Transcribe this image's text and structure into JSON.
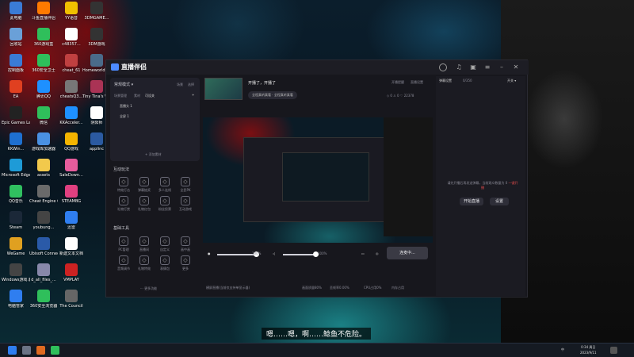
{
  "desktop": {
    "icons": [
      {
        "label": "此电脑",
        "color": "#3a7bd5"
      },
      {
        "label": "斗鱼直播伴侣",
        "color": "#ff7a00"
      },
      {
        "label": "YY语音",
        "color": "#f0c000"
      },
      {
        "label": "3DMGAME...",
        "color": "#333333"
      },
      {
        "label": "回收站",
        "color": "#6aa0d8"
      },
      {
        "label": "360游戏盒",
        "color": "#2fbf5b"
      },
      {
        "label": "c48357...",
        "color": "#ffffff"
      },
      {
        "label": "3DM游戏",
        "color": "#333333"
      },
      {
        "label": "控制面板",
        "color": "#3a7bd5"
      },
      {
        "label": "360安全卫士",
        "color": "#2fbf5b"
      },
      {
        "label": "cheat_61",
        "color": "#c04040"
      },
      {
        "label": "Homeworld Remaster...",
        "color": "#4a6b8a"
      },
      {
        "label": "EA",
        "color": "#e04020"
      },
      {
        "label": "腾讯QQ",
        "color": "#1e90ff"
      },
      {
        "label": "cheatsQ3...",
        "color": "#777777"
      },
      {
        "label": "Tiny Tina's Wonderlands",
        "color": "#aa3355"
      },
      {
        "label": "Epic Games Launcher",
        "color": "#222222"
      },
      {
        "label": "微信",
        "color": "#2fbf5b"
      },
      {
        "label": "KKAcceler...",
        "color": "#1e90ff"
      },
      {
        "label": "阴阳师",
        "color": "#ffffff"
      },
      {
        "label": "KKWin...",
        "color": "#1e6fd0"
      },
      {
        "label": "游戏库加速器",
        "color": "#4a90e2"
      },
      {
        "label": "QQ游戏",
        "color": "#f4b400"
      },
      {
        "label": "applinc",
        "color": "#2b5aa0"
      },
      {
        "label": "Microsoft Edge",
        "color": "#1e9bd7"
      },
      {
        "label": "assets",
        "color": "#f2c94c"
      },
      {
        "label": "SaleDown...",
        "color": "#e65c9c"
      },
      {
        "label": "QQ音乐",
        "color": "#30c060"
      },
      {
        "label": "Cheat Engine 61",
        "color": "#6a6a6a"
      },
      {
        "label": "STEAMBG",
        "color": "#e04080"
      },
      {
        "label": "Steam",
        "color": "#1b2838"
      },
      {
        "label": "youbung...",
        "color": "#444444"
      },
      {
        "label": "迅雷",
        "color": "#2f7ef0"
      },
      {
        "label": "WeGame",
        "color": "#e0a020"
      },
      {
        "label": "Ubisoft Connect",
        "color": "#2a5aa8"
      },
      {
        "label": "新建文本文档",
        "color": "#ffffff"
      },
      {
        "label": "Windows游戏 超级动画精灵",
        "color": "#444444"
      },
      {
        "label": "d_all_files_...",
        "color": "#8888aa"
      },
      {
        "label": "VMPLAY",
        "color": "#cc2222"
      },
      {
        "label": "电脑管家",
        "color": "#2f7ef0"
      },
      {
        "label": "360安全浏览器",
        "color": "#2fbf5b"
      },
      {
        "label": "The Council",
        "color": "#666666"
      }
    ]
  },
  "app": {
    "title": "直播伴侣",
    "mode_label": "常规模式 ▾",
    "scene_tabs": [
      "场景",
      "选择"
    ],
    "source_tabs": [
      "场景管理",
      "素材",
      "可设关"
    ],
    "sources": [
      "直播头 1",
      "全屏 1"
    ],
    "add_source": "+ 添加素材",
    "interact_title": "互动玩法",
    "interact_items": [
      "特效打击",
      "弹幕抽奖",
      "多人连线",
      "全民PK",
      "礼物打赏",
      "礼物红包",
      "粉丝投票",
      "互动游戏"
    ],
    "tools_title": "基础工具",
    "tools_items": [
      "PC管理",
      "直播间",
      "自定义",
      "画中画",
      "音频调节",
      "礼物特效",
      "表情包",
      "更多"
    ],
    "more": "··· 更多功能",
    "stream_title": "开播了，开播了",
    "stream_tags": [
      "全程真听真看 · 全程真听真看"
    ],
    "header_buttons": {
      "notice": "开播提醒",
      "settings": "直播设置"
    },
    "stats": [
      "0",
      "0",
      "22378"
    ],
    "volume_mic": "100%",
    "volume_speaker": "100%",
    "start_button": "连麦中...",
    "status_items": [
      "横屏直播(当前仅支持单显示器)",
      "画面质量80%",
      "丢帧率0.00%",
      "CPU占用0%",
      "内存占用"
    ],
    "right_tabs": [
      "弹幕设置",
      "0/350",
      "开关 ▾"
    ],
    "right_msg": "请先开播后再发送弹幕，当前观众数量为 0",
    "right_link": "一键开播",
    "right_buttons": [
      "开始直播",
      "设置"
    ]
  },
  "subtitle": "嗯……嗯，啊……鲶鱼不危险。",
  "taskbar": {
    "time": "0:34 周日",
    "date": "2023/9/11",
    "tray_text": "中"
  }
}
